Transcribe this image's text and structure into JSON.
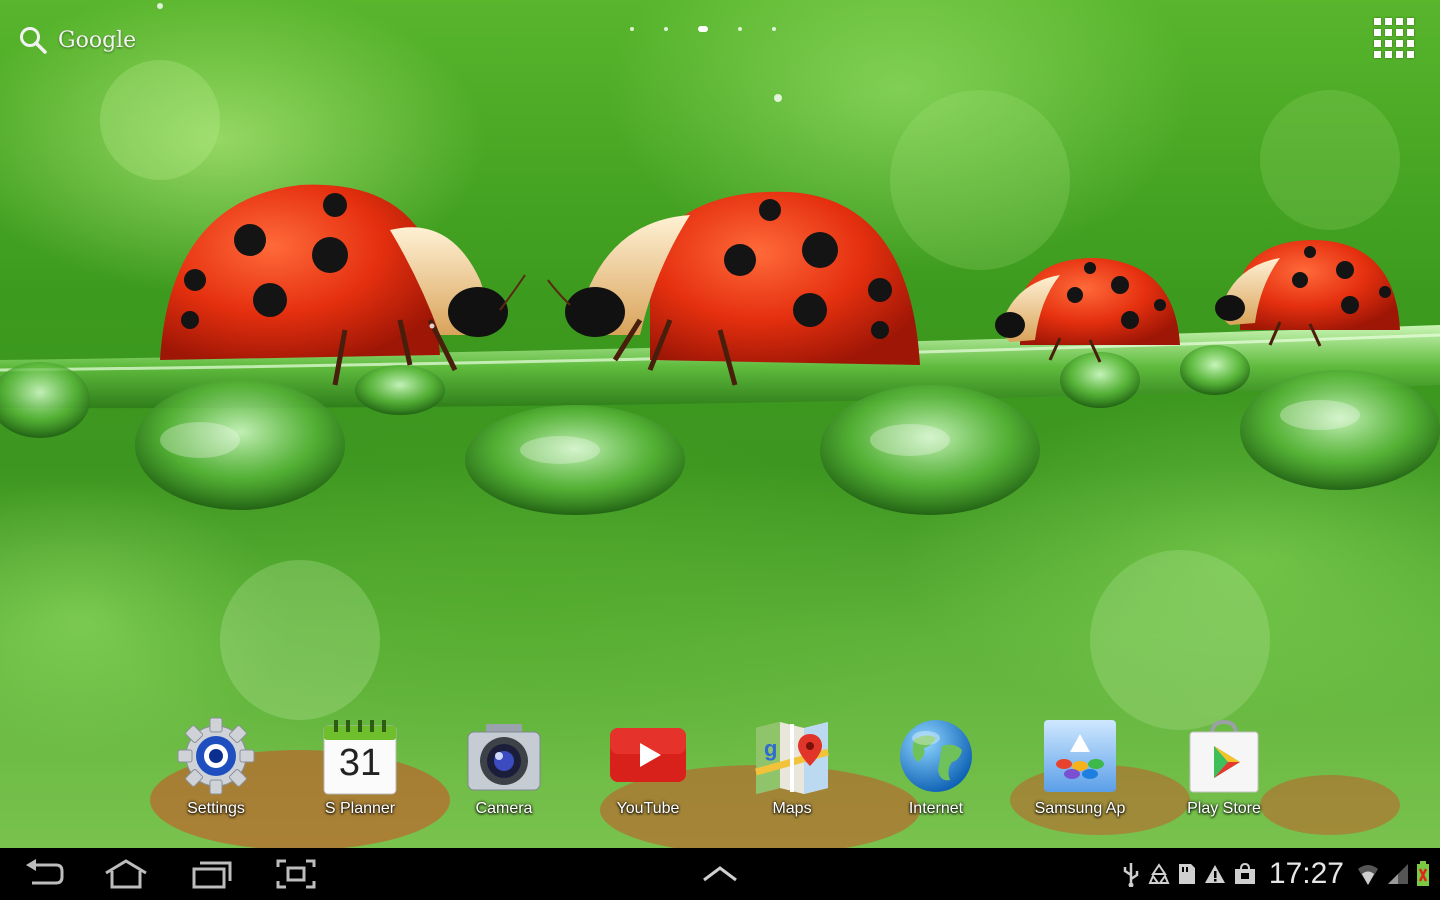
{
  "search": {
    "label": "Google",
    "icon": "search-icon"
  },
  "home_pages": {
    "count": 5,
    "active_index": 2
  },
  "apps_button": {
    "icon": "apps-grid-icon"
  },
  "dock": [
    {
      "label": "Settings",
      "icon": "settings-icon"
    },
    {
      "label": "S Planner",
      "icon": "calendar-icon",
      "date": "31"
    },
    {
      "label": "Camera",
      "icon": "camera-icon"
    },
    {
      "label": "YouTube",
      "icon": "youtube-icon"
    },
    {
      "label": "Maps",
      "icon": "maps-icon"
    },
    {
      "label": "Internet",
      "icon": "globe-icon"
    },
    {
      "label": "Samsung Ap",
      "icon": "samsung-apps-icon"
    },
    {
      "label": "Play Store",
      "icon": "play-store-icon"
    }
  ],
  "navbar": {
    "buttons": [
      "back-icon",
      "home-icon",
      "recent-apps-icon",
      "screenshot-icon"
    ],
    "center": "chevron-up-icon"
  },
  "status_bar": {
    "time": "17:27",
    "icons": [
      "usb-icon",
      "sync-icon",
      "sd-card-icon",
      "warning-icon",
      "shopping-bag-icon",
      "wifi-icon",
      "signal-icon",
      "battery-icon"
    ],
    "battery_color": "#7ac943"
  }
}
